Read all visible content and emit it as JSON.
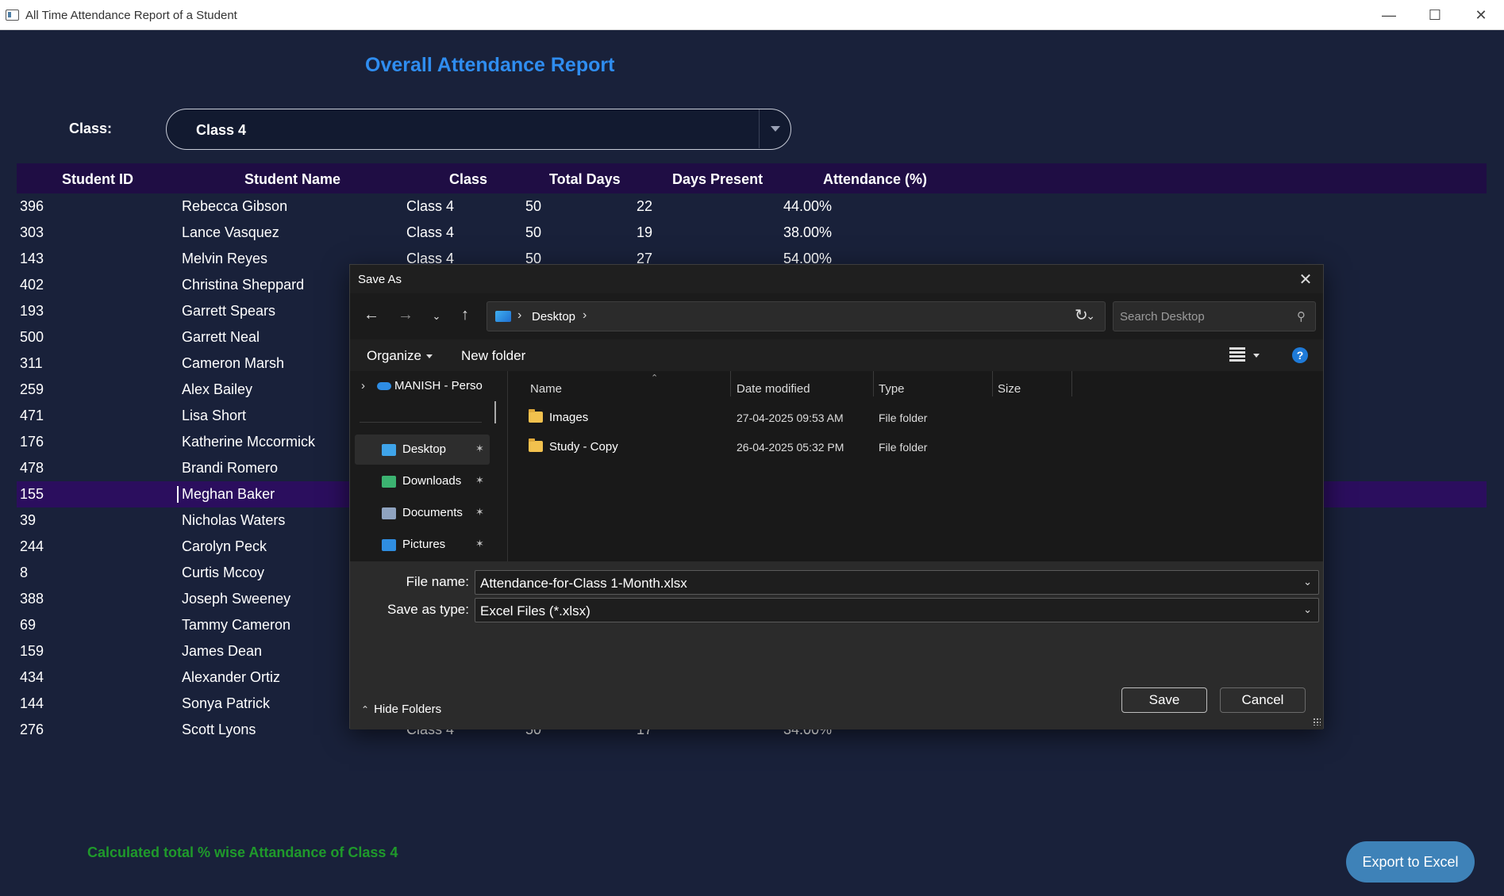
{
  "window": {
    "title": "All Time Attendance Report of a Student",
    "controls": [
      "minimize-icon",
      "maximize-icon",
      "close-icon"
    ]
  },
  "report": {
    "title": "Overall Attendance Report",
    "class_label": "Class:",
    "class_value": "Class 4"
  },
  "table": {
    "headers": [
      "Student ID",
      "Student Name",
      "Class",
      "Total Days",
      "Days Present",
      "Attendance (%)"
    ],
    "rows": [
      [
        "396",
        "Rebecca Gibson",
        "Class 4",
        "50",
        "22",
        "44.00%"
      ],
      [
        "303",
        "Lance Vasquez",
        "Class 4",
        "50",
        "19",
        "38.00%"
      ],
      [
        "143",
        "Melvin Reyes",
        "Class 4",
        "50",
        "27",
        "54.00%"
      ],
      [
        "402",
        "Christina Sheppard",
        "",
        "",
        "",
        ""
      ],
      [
        "193",
        "Garrett Spears",
        "",
        "",
        "",
        ""
      ],
      [
        "500",
        "Garrett Neal",
        "",
        "",
        "",
        ""
      ],
      [
        "311",
        "Cameron Marsh",
        "",
        "",
        "",
        ""
      ],
      [
        "259",
        "Alex Bailey",
        "",
        "",
        "",
        ""
      ],
      [
        "471",
        "Lisa Short",
        "",
        "",
        "",
        ""
      ],
      [
        "176",
        "Katherine Mccormick",
        "",
        "",
        "",
        ""
      ],
      [
        "478",
        "Brandi Romero",
        "",
        "",
        "",
        ""
      ],
      [
        "155",
        "Meghan Baker",
        "",
        "",
        "",
        ""
      ],
      [
        "39",
        "Nicholas Waters",
        "",
        "",
        "",
        ""
      ],
      [
        "244",
        "Carolyn Peck",
        "",
        "",
        "",
        ""
      ],
      [
        "8",
        "Curtis Mccoy",
        "",
        "",
        "",
        ""
      ],
      [
        "388",
        "Joseph Sweeney",
        "",
        "",
        "",
        ""
      ],
      [
        "69",
        "Tammy Cameron",
        "",
        "",
        "",
        ""
      ],
      [
        "159",
        "James Dean",
        "",
        "",
        "",
        ""
      ],
      [
        "434",
        "Alexander Ortiz",
        "",
        "",
        "",
        ""
      ],
      [
        "144",
        "Sonya Patrick",
        "",
        "",
        "",
        ""
      ],
      [
        "276",
        "Scott Lyons",
        "Class 4",
        "50",
        "17",
        "34.00%"
      ]
    ],
    "selected_row_index": 11
  },
  "footer": {
    "summary": "Calculated total % wise Attandance of Class 4",
    "export_label": "Export to Excel"
  },
  "dialog": {
    "title": "Save As",
    "breadcrumb": "Desktop",
    "search_placeholder": "Search Desktop",
    "organize_label": "Organize",
    "new_folder_label": "New folder",
    "nav": {
      "onedrive_label": "MANISH - Perso",
      "items": [
        {
          "label": "Desktop",
          "icon": "desktop-icon",
          "active": true
        },
        {
          "label": "Downloads",
          "icon": "download-icon",
          "active": false
        },
        {
          "label": "Documents",
          "icon": "document-icon",
          "active": false
        },
        {
          "label": "Pictures",
          "icon": "pictures-icon",
          "active": false
        }
      ]
    },
    "columns": [
      "Name",
      "Date modified",
      "Type",
      "Size"
    ],
    "files": [
      {
        "name": "Images",
        "date": "27-04-2025 09:53 AM",
        "type": "File folder",
        "size": ""
      },
      {
        "name": "Study - Copy",
        "date": "26-04-2025 05:32 PM",
        "type": "File folder",
        "size": ""
      }
    ],
    "file_name_label": "File name:",
    "file_name_value": "Attendance-for-Class 1-Month.xlsx",
    "save_type_label": "Save as type:",
    "save_type_value": "Excel Files (*.xlsx)",
    "hide_folders_label": "Hide Folders",
    "save_label": "Save",
    "cancel_label": "Cancel"
  }
}
